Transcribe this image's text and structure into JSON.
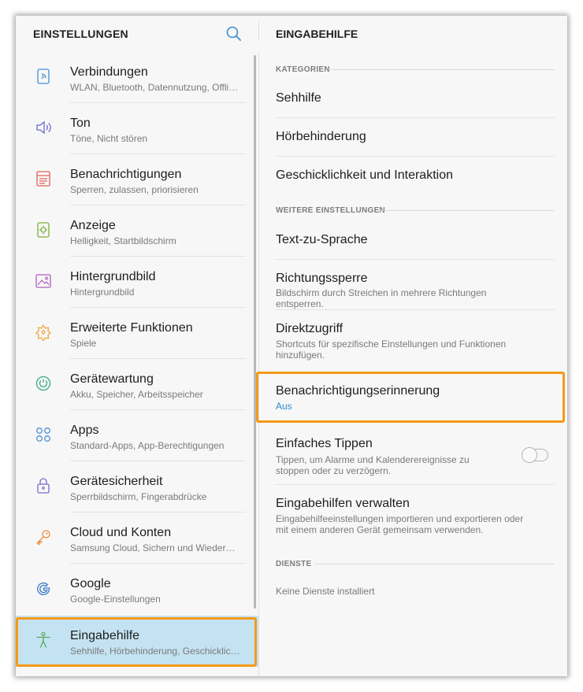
{
  "left_panel": {
    "title": "EINSTELLUNGEN",
    "search_icon": "search-icon",
    "items": [
      {
        "title": "Verbindungen",
        "subtitle": "WLAN, Bluetooth, Datennutzung, Offline...",
        "icon": "connections-icon",
        "color": "#4a90d6"
      },
      {
        "title": "Ton",
        "subtitle": "Töne, Nicht stören",
        "icon": "sound-icon",
        "color": "#6c6ad2"
      },
      {
        "title": "Benachrichtigungen",
        "subtitle": "Sperren, zulassen, priorisieren",
        "icon": "notifications-icon",
        "color": "#e0605a"
      },
      {
        "title": "Anzeige",
        "subtitle": "Helligkeit, Startbildschirm",
        "icon": "display-icon",
        "color": "#7bb03a"
      },
      {
        "title": "Hintergrundbild",
        "subtitle": "Hintergrundbild",
        "icon": "wallpaper-icon",
        "color": "#b060c0"
      },
      {
        "title": "Erweiterte Funktionen",
        "subtitle": "Spiele",
        "icon": "advanced-features-icon",
        "color": "#f0a030"
      },
      {
        "title": "Gerätewartung",
        "subtitle": "Akku, Speicher, Arbeitsspeicher",
        "icon": "device-maintenance-icon",
        "color": "#3aaa8a"
      },
      {
        "title": "Apps",
        "subtitle": "Standard-Apps, App-Berechtigungen",
        "icon": "apps-icon",
        "color": "#4a90d6"
      },
      {
        "title": "Gerätesicherheit",
        "subtitle": "Sperrbildschirm, Fingerabdrücke",
        "icon": "lock-icon",
        "color": "#7a6ad0"
      },
      {
        "title": "Cloud und Konten",
        "subtitle": "Samsung Cloud, Sichern und Wiederher...",
        "icon": "key-icon",
        "color": "#f08a30"
      },
      {
        "title": "Google",
        "subtitle": "Google-Einstellungen",
        "icon": "google-icon",
        "color": "#3a78c8"
      },
      {
        "title": "Eingabehilfe",
        "subtitle": "Sehhilfe, Hörbehinderung, Geschicklich...",
        "icon": "accessibility-icon",
        "color": "#5aa85a",
        "selected": true
      }
    ]
  },
  "right_panel": {
    "title": "EINGABEHILFE",
    "sections": {
      "categories": "KATEGORIEN",
      "more_settings": "WEITERE EINSTELLUNGEN",
      "services": "DIENSTE"
    },
    "category_items": [
      "Sehhilfe",
      "Hörbehinderung",
      "Geschicklichkeit und Interaktion"
    ],
    "text_to_speech": "Text-zu-Sprache",
    "direction_lock": {
      "title": "Richtungssperre",
      "subtitle": "Bildschirm durch Streichen in mehrere Richtungen entsperren."
    },
    "direct_access": {
      "title": "Direktzugriff",
      "subtitle": "Shortcuts für spezifische Einstellungen und Funktionen hinzufügen."
    },
    "notification_reminder": {
      "title": "Benachrichtigungserinnerung",
      "value": "Aus"
    },
    "easy_tap": {
      "title": "Einfaches Tippen",
      "subtitle": "Tippen, um Alarme und Kalenderereignisse zu stoppen oder zu verzögern.",
      "toggle_on": false
    },
    "manage_accessibility": {
      "title": "Eingabehilfen verwalten",
      "subtitle": "Eingabehilfeeinstellungen importieren und exportieren oder mit einem anderen Gerät gemeinsam verwenden."
    },
    "no_services": "Keine Dienste installiert"
  },
  "colors": {
    "highlight": "#f49a17",
    "selected_bg": "#c4e3f2",
    "accent_blue": "#2c8bc9"
  }
}
